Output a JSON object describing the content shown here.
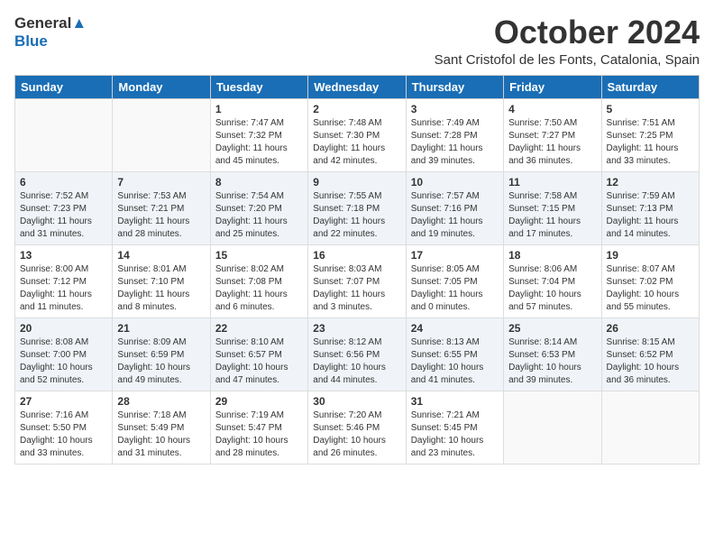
{
  "logo": {
    "line1": "General",
    "line2": "Blue"
  },
  "title": "October 2024",
  "location": "Sant Cristofol de les Fonts, Catalonia, Spain",
  "weekdays": [
    "Sunday",
    "Monday",
    "Tuesday",
    "Wednesday",
    "Thursday",
    "Friday",
    "Saturday"
  ],
  "weeks": [
    [
      {
        "day": "",
        "info": ""
      },
      {
        "day": "",
        "info": ""
      },
      {
        "day": "1",
        "info": "Sunrise: 7:47 AM\nSunset: 7:32 PM\nDaylight: 11 hours and 45 minutes."
      },
      {
        "day": "2",
        "info": "Sunrise: 7:48 AM\nSunset: 7:30 PM\nDaylight: 11 hours and 42 minutes."
      },
      {
        "day": "3",
        "info": "Sunrise: 7:49 AM\nSunset: 7:28 PM\nDaylight: 11 hours and 39 minutes."
      },
      {
        "day": "4",
        "info": "Sunrise: 7:50 AM\nSunset: 7:27 PM\nDaylight: 11 hours and 36 minutes."
      },
      {
        "day": "5",
        "info": "Sunrise: 7:51 AM\nSunset: 7:25 PM\nDaylight: 11 hours and 33 minutes."
      }
    ],
    [
      {
        "day": "6",
        "info": "Sunrise: 7:52 AM\nSunset: 7:23 PM\nDaylight: 11 hours and 31 minutes."
      },
      {
        "day": "7",
        "info": "Sunrise: 7:53 AM\nSunset: 7:21 PM\nDaylight: 11 hours and 28 minutes."
      },
      {
        "day": "8",
        "info": "Sunrise: 7:54 AM\nSunset: 7:20 PM\nDaylight: 11 hours and 25 minutes."
      },
      {
        "day": "9",
        "info": "Sunrise: 7:55 AM\nSunset: 7:18 PM\nDaylight: 11 hours and 22 minutes."
      },
      {
        "day": "10",
        "info": "Sunrise: 7:57 AM\nSunset: 7:16 PM\nDaylight: 11 hours and 19 minutes."
      },
      {
        "day": "11",
        "info": "Sunrise: 7:58 AM\nSunset: 7:15 PM\nDaylight: 11 hours and 17 minutes."
      },
      {
        "day": "12",
        "info": "Sunrise: 7:59 AM\nSunset: 7:13 PM\nDaylight: 11 hours and 14 minutes."
      }
    ],
    [
      {
        "day": "13",
        "info": "Sunrise: 8:00 AM\nSunset: 7:12 PM\nDaylight: 11 hours and 11 minutes."
      },
      {
        "day": "14",
        "info": "Sunrise: 8:01 AM\nSunset: 7:10 PM\nDaylight: 11 hours and 8 minutes."
      },
      {
        "day": "15",
        "info": "Sunrise: 8:02 AM\nSunset: 7:08 PM\nDaylight: 11 hours and 6 minutes."
      },
      {
        "day": "16",
        "info": "Sunrise: 8:03 AM\nSunset: 7:07 PM\nDaylight: 11 hours and 3 minutes."
      },
      {
        "day": "17",
        "info": "Sunrise: 8:05 AM\nSunset: 7:05 PM\nDaylight: 11 hours and 0 minutes."
      },
      {
        "day": "18",
        "info": "Sunrise: 8:06 AM\nSunset: 7:04 PM\nDaylight: 10 hours and 57 minutes."
      },
      {
        "day": "19",
        "info": "Sunrise: 8:07 AM\nSunset: 7:02 PM\nDaylight: 10 hours and 55 minutes."
      }
    ],
    [
      {
        "day": "20",
        "info": "Sunrise: 8:08 AM\nSunset: 7:00 PM\nDaylight: 10 hours and 52 minutes."
      },
      {
        "day": "21",
        "info": "Sunrise: 8:09 AM\nSunset: 6:59 PM\nDaylight: 10 hours and 49 minutes."
      },
      {
        "day": "22",
        "info": "Sunrise: 8:10 AM\nSunset: 6:57 PM\nDaylight: 10 hours and 47 minutes."
      },
      {
        "day": "23",
        "info": "Sunrise: 8:12 AM\nSunset: 6:56 PM\nDaylight: 10 hours and 44 minutes."
      },
      {
        "day": "24",
        "info": "Sunrise: 8:13 AM\nSunset: 6:55 PM\nDaylight: 10 hours and 41 minutes."
      },
      {
        "day": "25",
        "info": "Sunrise: 8:14 AM\nSunset: 6:53 PM\nDaylight: 10 hours and 39 minutes."
      },
      {
        "day": "26",
        "info": "Sunrise: 8:15 AM\nSunset: 6:52 PM\nDaylight: 10 hours and 36 minutes."
      }
    ],
    [
      {
        "day": "27",
        "info": "Sunrise: 7:16 AM\nSunset: 5:50 PM\nDaylight: 10 hours and 33 minutes."
      },
      {
        "day": "28",
        "info": "Sunrise: 7:18 AM\nSunset: 5:49 PM\nDaylight: 10 hours and 31 minutes."
      },
      {
        "day": "29",
        "info": "Sunrise: 7:19 AM\nSunset: 5:47 PM\nDaylight: 10 hours and 28 minutes."
      },
      {
        "day": "30",
        "info": "Sunrise: 7:20 AM\nSunset: 5:46 PM\nDaylight: 10 hours and 26 minutes."
      },
      {
        "day": "31",
        "info": "Sunrise: 7:21 AM\nSunset: 5:45 PM\nDaylight: 10 hours and 23 minutes."
      },
      {
        "day": "",
        "info": ""
      },
      {
        "day": "",
        "info": ""
      }
    ]
  ]
}
